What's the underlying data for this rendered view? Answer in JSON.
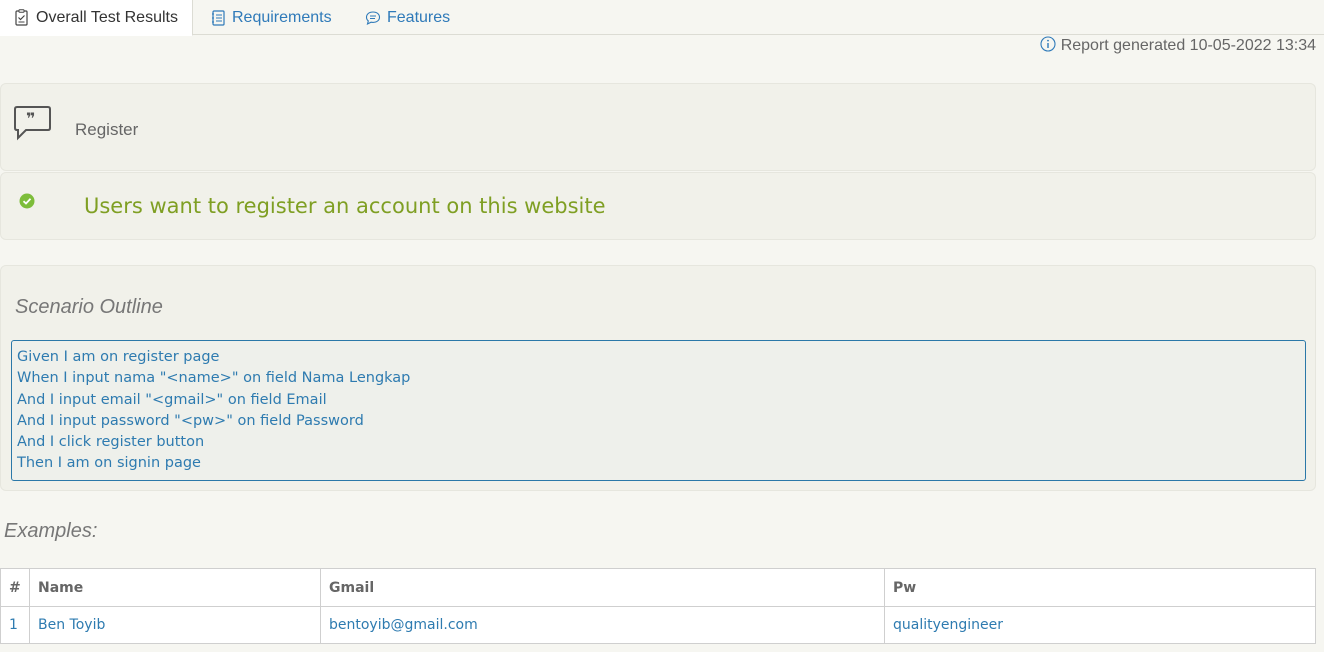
{
  "tabs": [
    {
      "label": "Overall Test Results",
      "icon": "checklist-icon",
      "active": true
    },
    {
      "label": "Requirements",
      "icon": "book-icon",
      "active": false
    },
    {
      "label": "Features",
      "icon": "comment-icon",
      "active": false
    }
  ],
  "report": {
    "text": "Report generated 10-05-2022 13:34",
    "icon": "info-icon"
  },
  "feature": {
    "label": "Register",
    "icon": "quote-bubble-icon"
  },
  "story": {
    "title": "Users want to register an account on this website",
    "status": "passed",
    "status_color": "#7dbd3a"
  },
  "scenario": {
    "title": "Scenario Outline",
    "steps": [
      "Given I am on register page",
      "When I input nama \"<name>\" on field Nama Lengkap",
      "And I input email \"<gmail>\" on field Email",
      "And I input password \"<pw>\" on field Password",
      "And I click register button",
      "Then I am on signin page"
    ]
  },
  "examples": {
    "title": "Examples:",
    "headers": [
      "#",
      "Name",
      "Gmail",
      "Pw"
    ],
    "rows": [
      [
        "1",
        "Ben Toyib",
        "bentoyib@gmail.com",
        "qualityengineer"
      ]
    ]
  },
  "colors": {
    "link": "#2e7bb0",
    "passed": "#7f9f23",
    "border": "#2b78a8"
  }
}
